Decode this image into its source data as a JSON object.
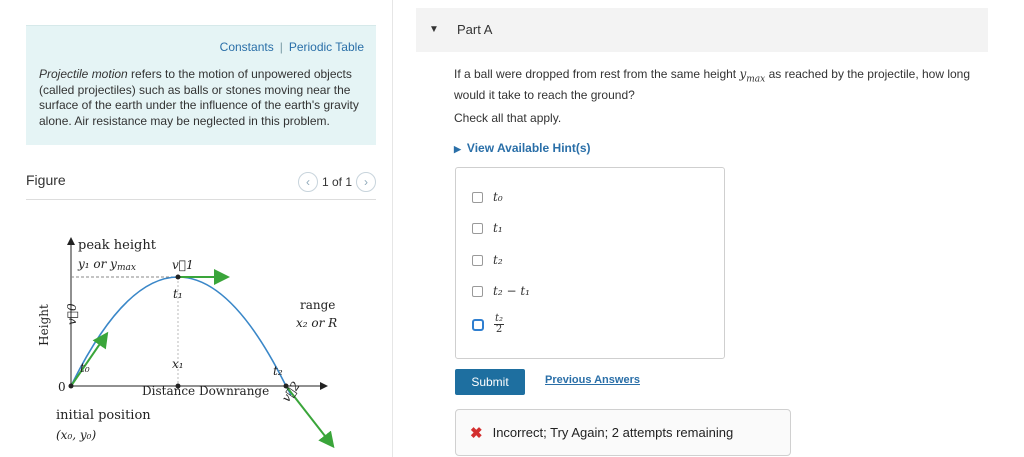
{
  "intro": {
    "links": [
      "Constants",
      "Periodic Table"
    ],
    "separator": "|",
    "lead_italic": "Projectile motion",
    "text": " refers to the motion of unpowered objects (called projectiles) such as balls or stones moving near the surface of the earth under the influence of the earth's gravity alone. Air resistance may be neglected in this problem."
  },
  "figure": {
    "title": "Figure",
    "pager": "1 of 1",
    "prev_icon": "chevron-left-icon",
    "next_icon": "chevron-right-icon",
    "labels": {
      "peak": "peak height",
      "peak_sub": "y₁ or y",
      "peak_sub2": "max",
      "height": "Height",
      "v0": "v⃗0",
      "v1": "v⃗1",
      "t1": "t₁",
      "t0": "t₀",
      "x1": "x₁",
      "t2": "t₂",
      "range1": "range",
      "range2": "x₂ or R",
      "origin": "0",
      "downrange": "Distance Downrange",
      "v2": "v⃗2",
      "init1": "initial position",
      "init2": "(x₀, y₀)"
    },
    "colors": {
      "trajectory": "#3a87c8",
      "vector": "#3aa53a"
    }
  },
  "part": {
    "title": "Part A",
    "caret_icon": "caret-down-icon",
    "question_a": "If a ball were dropped from rest from the same height ",
    "question_var": "y",
    "question_sub": "max",
    "question_b": " as reached by the projectile, how long would it take to reach the ground?",
    "instruction": "Check all that apply.",
    "hint": "View Available Hint(s)",
    "choices": [
      "t₀",
      "t₁",
      "t₂",
      "t₂ − t₁"
    ],
    "frac_num": "t₂",
    "frac_den": "2",
    "submit": "Submit",
    "previous": "Previous Answers",
    "feedback": "Incorrect; Try Again; 2 attempts remaining",
    "feedback_icon": "x-icon",
    "colors": {
      "accent": "#1e6fa0",
      "link": "#2a6fa8",
      "error": "#d32f2f"
    }
  }
}
